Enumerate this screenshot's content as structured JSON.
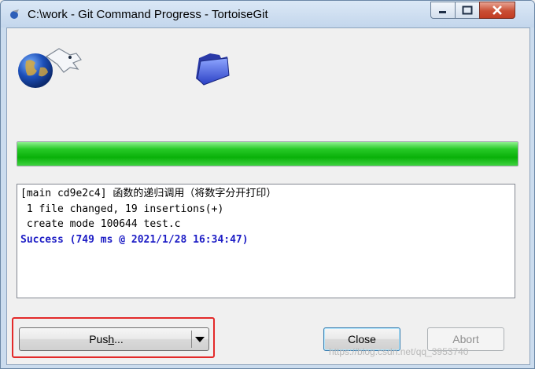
{
  "window": {
    "title": "C:\\work - Git Command Progress - TortoiseGit",
    "controls": [
      "minimize-icon",
      "maximize-icon",
      "close-icon"
    ]
  },
  "icons": {
    "logo": "tortoisegit-globe-icon",
    "folder": "folder-icon"
  },
  "progress": {
    "value": 1.0,
    "color": "#1ebd1e"
  },
  "log": {
    "lines": [
      "[main cd9e2c4] 函数的递归调用（将数字分开打印）",
      " 1 file changed, 19 insertions(+)",
      " create mode 100644 test.c",
      "",
      "Success (749 ms @ 2021/1/28 16:34:47)"
    ],
    "success_color": "#1d1dc5"
  },
  "buttons": {
    "push": "Push...",
    "close": "Close",
    "abort": "Abort"
  },
  "annotation": {
    "color": "#e32a2a"
  },
  "watermark": "https://blog.csdn.net/qq_3953740"
}
